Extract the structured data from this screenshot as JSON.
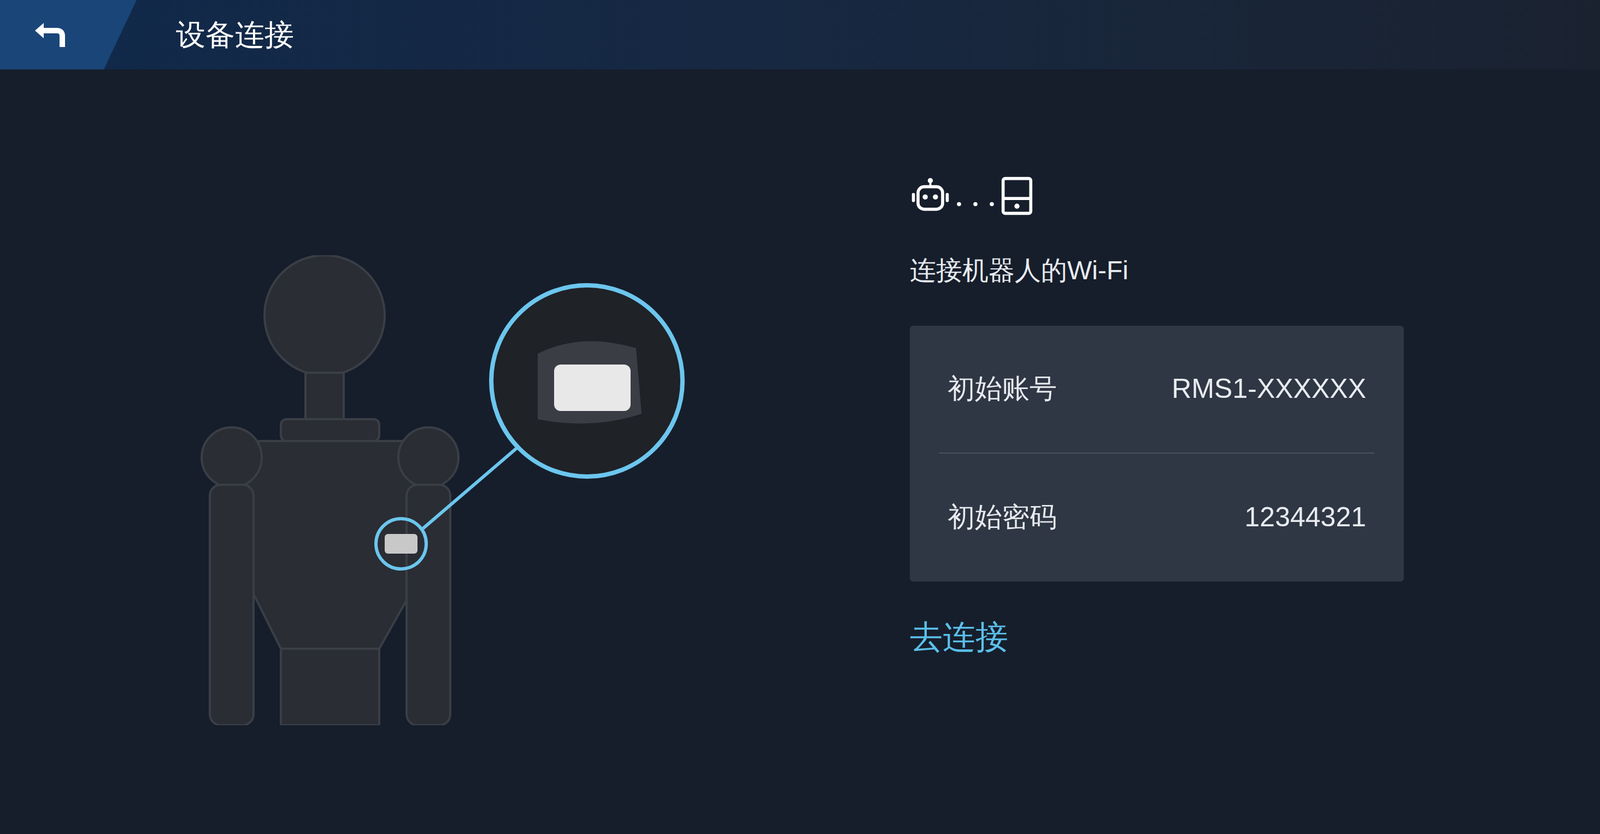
{
  "header": {
    "title": "设备连接"
  },
  "connect": {
    "heading": "连接机器人的Wi-Fi",
    "credentials": [
      {
        "label": "初始账号",
        "value": "RMS1-XXXXXX"
      },
      {
        "label": "初始密码",
        "value": "12344321"
      }
    ],
    "action": "去连接"
  }
}
